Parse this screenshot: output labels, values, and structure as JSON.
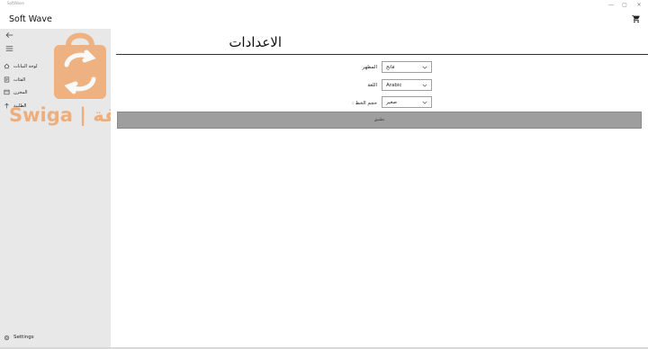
{
  "window": {
    "title": "SoftWave",
    "controls": [
      "—",
      "▢",
      "✕"
    ]
  },
  "appbar": {
    "app_name": "Soft Wave",
    "cart_icon": "shopping-cart-icon"
  },
  "sidebar": {
    "back_icon": "back-arrow-icon",
    "menu_icon": "hamburger-menu-icon",
    "items": [
      {
        "label": "لوحة البيانات",
        "icon": "home-icon"
      },
      {
        "label": "الفئات",
        "icon": "categories-icon"
      },
      {
        "label": "المخزن",
        "icon": "store-icon"
      },
      {
        "label": "الطلبية",
        "icon": "upload-icon"
      }
    ],
    "settings_label": "Settings",
    "settings_icon": "gear-icon"
  },
  "watermark": {
    "brand_latin": "Swiga",
    "separator": "|",
    "brand_arabic": "سوايقة",
    "color": "#f0a060"
  },
  "main": {
    "title": "الاعدادات",
    "settings": [
      {
        "label": "المظهر",
        "value": "فاتح"
      },
      {
        "label": "اللغة",
        "value": "Arabic"
      },
      {
        "label": "حجم الخط :",
        "value": "صغير"
      }
    ],
    "apply_label": "تطبيق"
  },
  "colors": {
    "sidebar_bg": "#e8e8e8",
    "button_bg": "#9e9e9e",
    "accent_watermark": "#f0a060"
  }
}
